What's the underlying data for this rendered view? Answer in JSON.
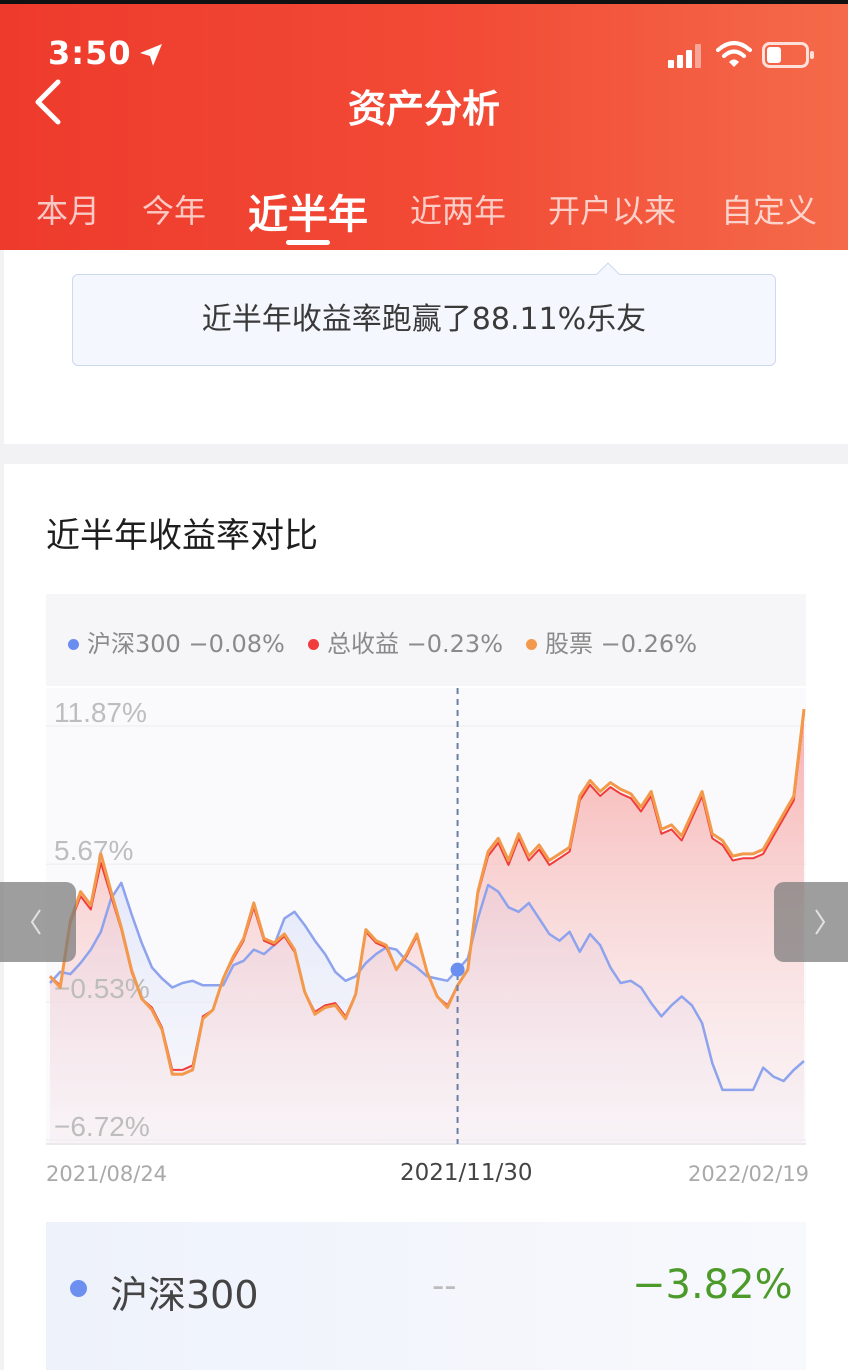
{
  "status_bar": {
    "time": "3:50"
  },
  "nav": {
    "title": "资产分析"
  },
  "tabs": [
    {
      "label": "本月"
    },
    {
      "label": "今年"
    },
    {
      "label": "近半年",
      "active": true
    },
    {
      "label": "近两年"
    },
    {
      "label": "开户以来"
    },
    {
      "label": "自定义"
    }
  ],
  "tip": {
    "text": "近半年收益率跑赢了88.11%乐友"
  },
  "section": {
    "title": "近半年收益率对比"
  },
  "legend": [
    {
      "name": "沪深300",
      "value": "−0.08%",
      "color": "#6a8ef0"
    },
    {
      "name": "总收益",
      "value": "−0.23%",
      "color": "#f03c3c"
    },
    {
      "name": "股票",
      "value": "−0.26%",
      "color": "#f3994b"
    }
  ],
  "chart_data": {
    "type": "line",
    "x_range": [
      "2021/08/24",
      "2022/02/19"
    ],
    "y_tick_labels": [
      "11.87%",
      "5.67%",
      "−0.53%",
      "−6.72%"
    ],
    "ylim": [
      -6.72,
      11.87
    ],
    "x_labels": [
      "2021/08/24",
      "2021/11/30",
      "2022/02/19"
    ],
    "cursor_date": "2021/11/30",
    "series": [
      {
        "name": "沪深300",
        "color": "#8ea3ee",
        "values": [
          -0.3,
          0.2,
          0.1,
          0.6,
          1.2,
          2.0,
          3.5,
          4.2,
          2.8,
          1.5,
          0.4,
          -0.1,
          -0.5,
          -0.3,
          -0.2,
          -0.4,
          -0.4,
          -0.4,
          0.5,
          0.7,
          1.2,
          1.0,
          1.4,
          2.6,
          2.9,
          2.3,
          1.6,
          1.0,
          0.2,
          -0.2,
          0.0,
          0.6,
          1.0,
          1.3,
          1.2,
          0.7,
          0.4,
          0.0,
          -0.1,
          -0.2,
          0.3,
          0.8,
          2.6,
          4.1,
          3.8,
          3.1,
          2.9,
          3.3,
          2.6,
          1.9,
          1.6,
          2.0,
          1.1,
          1.9,
          1.4,
          0.4,
          -0.3,
          -0.2,
          -0.5,
          -1.2,
          -1.8,
          -1.3,
          -0.9,
          -1.3,
          -2.1,
          -3.9,
          -5.1,
          -5.1,
          -5.1,
          -5.1,
          -4.1,
          -4.5,
          -4.7,
          -4.2,
          -3.8
        ]
      },
      {
        "name": "总收益",
        "color": "#f03c3c",
        "values": [
          0.0,
          -0.4,
          2.4,
          3.6,
          3.0,
          5.1,
          3.6,
          2.1,
          0.2,
          -1.0,
          -1.4,
          -2.3,
          -4.2,
          -4.2,
          -4.0,
          -1.8,
          -1.5,
          -0.1,
          0.8,
          1.6,
          3.1,
          1.6,
          1.4,
          1.8,
          1.1,
          -0.7,
          -1.6,
          -1.3,
          -1.2,
          -1.8,
          -0.8,
          2.0,
          1.5,
          1.3,
          0.3,
          0.9,
          1.8,
          0.2,
          -0.9,
          -1.3,
          -0.4,
          0.3,
          3.7,
          5.4,
          6.0,
          5.0,
          6.2,
          5.2,
          5.7,
          5.0,
          5.3,
          5.6,
          7.9,
          8.6,
          8.1,
          8.5,
          8.2,
          8.0,
          7.4,
          8.1,
          6.4,
          6.6,
          6.1,
          7.1,
          8.1,
          6.2,
          5.9,
          5.2,
          5.3,
          5.3,
          5.5,
          6.3,
          7.1,
          7.9,
          11.8
        ]
      },
      {
        "name": "股票",
        "color": "#f3994b",
        "values": [
          0.0,
          -0.5,
          2.5,
          3.8,
          3.2,
          5.5,
          3.8,
          2.2,
          0.3,
          -1.0,
          -1.5,
          -2.4,
          -4.4,
          -4.4,
          -4.2,
          -1.9,
          -1.5,
          -0.1,
          0.9,
          1.7,
          3.3,
          1.7,
          1.5,
          1.9,
          1.2,
          -0.7,
          -1.7,
          -1.4,
          -1.3,
          -1.9,
          -0.8,
          2.1,
          1.6,
          1.4,
          0.3,
          1.0,
          1.9,
          0.2,
          -0.9,
          -1.4,
          -0.4,
          0.3,
          3.8,
          5.6,
          6.2,
          5.2,
          6.4,
          5.4,
          5.9,
          5.2,
          5.5,
          5.8,
          8.1,
          8.8,
          8.3,
          8.7,
          8.4,
          8.2,
          7.6,
          8.3,
          6.6,
          6.8,
          6.3,
          7.3,
          8.3,
          6.4,
          6.1,
          5.4,
          5.5,
          5.5,
          5.7,
          6.5,
          7.3,
          8.1,
          12.0
        ]
      }
    ],
    "grid": true,
    "legend_position": "top"
  },
  "summary_row": {
    "name": "沪深300",
    "middle": "--",
    "value": "−3.82%",
    "dot_color": "#6c8ff0",
    "value_color": "#4c9a2a"
  }
}
